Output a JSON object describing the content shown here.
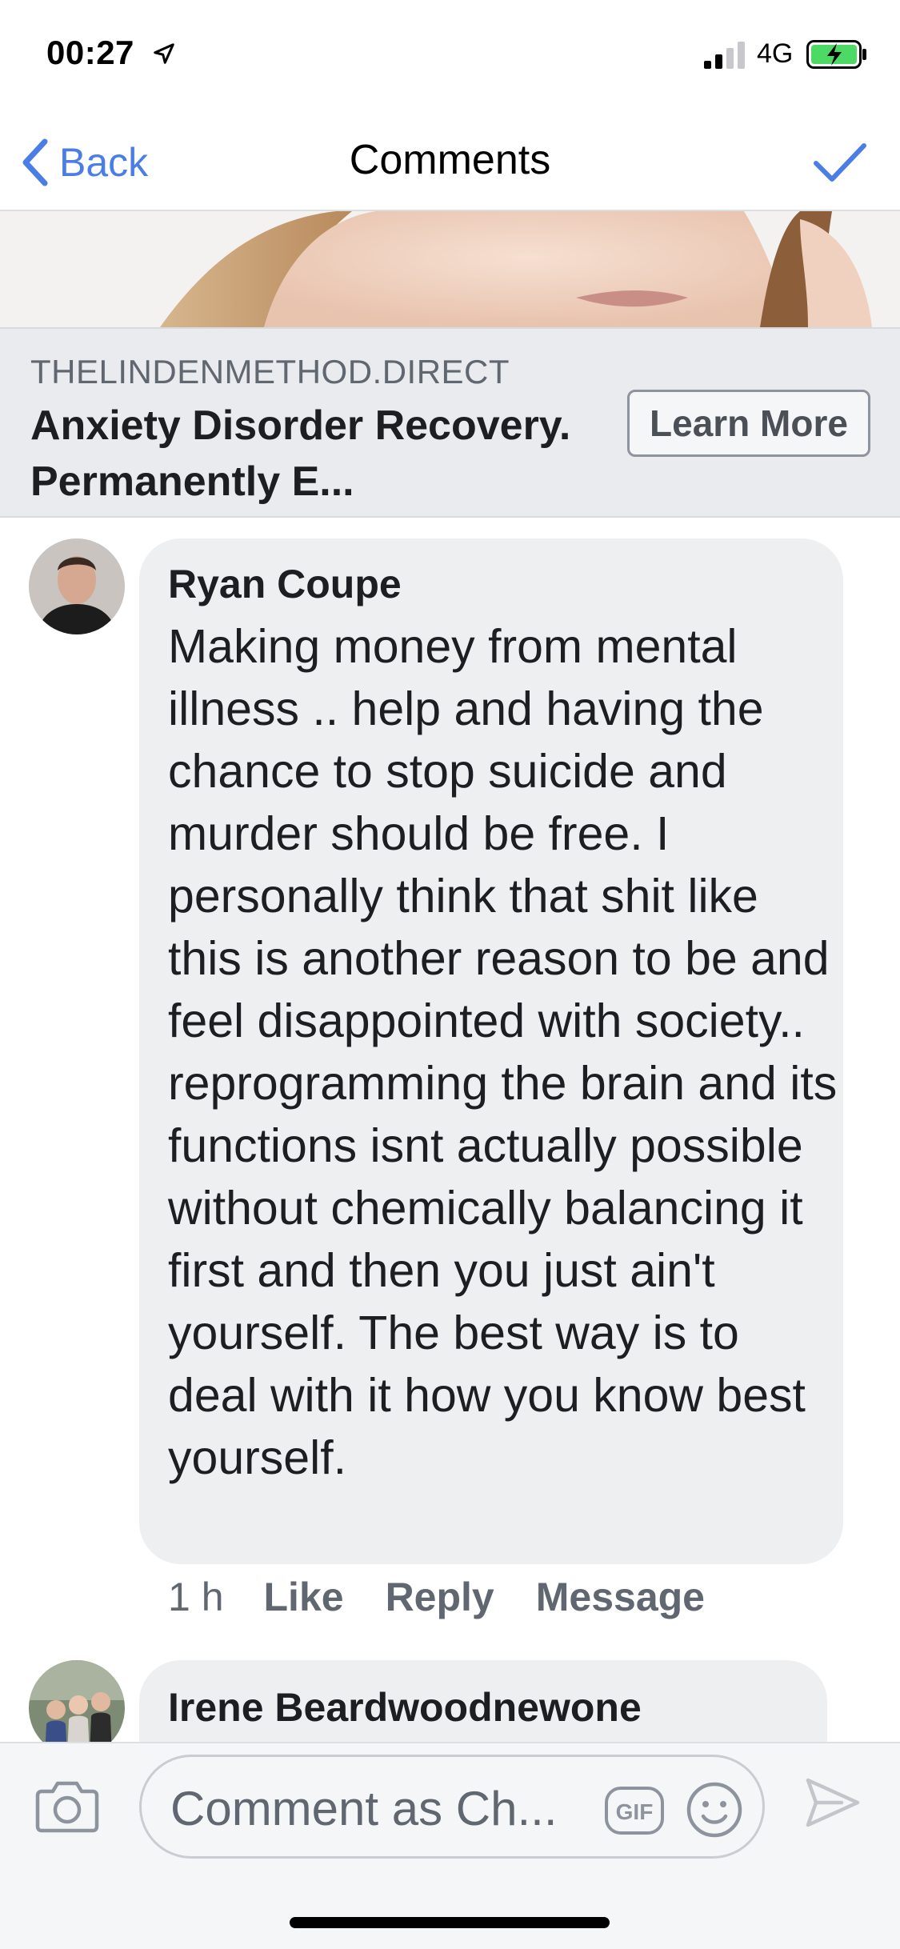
{
  "status_bar": {
    "time": "00:27",
    "network": "4G"
  },
  "nav": {
    "back_label": "Back",
    "title": "Comments"
  },
  "ad": {
    "domain": "THELINDENMETHOD.DIRECT",
    "headline": "Anxiety Disorder Recovery. Permanently E...",
    "cta_label": "Learn More"
  },
  "comments": [
    {
      "author": "Ryan Coupe",
      "text": "Making money from mental illness .. help and having the chance to stop suicide and murder should be free. I personally think that shit like this is another reason to be and feel disappointed with society.. reprogramming the brain and its functions isnt actually possible without chemically balancing it first and then you just ain't yourself. The best way is to deal with it how you know best yourself.",
      "time": "1 h",
      "like_label": "Like",
      "reply_label": "Reply",
      "message_label": "Message"
    },
    {
      "author": "Irene Beardwoodnewone"
    }
  ],
  "composer": {
    "placeholder": "Comment as Ch...",
    "gif_label": "GIF"
  },
  "colors": {
    "accent": "#4a7de6",
    "bubble": "#eeeff1",
    "battery_charge": "#4cd964"
  }
}
